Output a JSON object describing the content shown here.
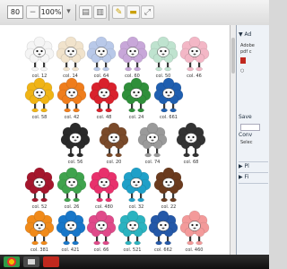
{
  "toolbar": {
    "page_number": "",
    "page_total": "80",
    "zoom": "100%"
  },
  "colors": {
    "accent_panel": "#eef2f7",
    "taskbar": "#1a1a1a",
    "pdf_red": "#c0281e"
  },
  "sheep": [
    {
      "label": "col. 12",
      "color": "#f5f5f5"
    },
    {
      "label": "col. 14",
      "color": "#f1e3cc"
    },
    {
      "label": "col. 64",
      "color": "#b9c9e9"
    },
    {
      "label": "col. 60",
      "color": "#c8a7d9"
    },
    {
      "label": "col. 50",
      "color": "#bfe3cf"
    },
    {
      "label": "col. 46",
      "color": "#f3b7c6"
    },
    {
      "label": "col. 58",
      "color": "#f0b416"
    },
    {
      "label": "col. 42",
      "color": "#ef7d1c"
    },
    {
      "label": "col. 48",
      "color": "#d9212c"
    },
    {
      "label": "col. 24",
      "color": "#2f8f3a"
    },
    {
      "label": "col. 661",
      "color": "#1f5fb0"
    },
    {
      "label": "col. 56",
      "color": "#2a2a2a"
    },
    {
      "label": "col. 20",
      "color": "#7a4a2a"
    },
    {
      "label": "col. 74",
      "color": "#9a9a9a"
    },
    {
      "label": "col. 68",
      "color": "#333333"
    },
    {
      "label": "col. 52",
      "color": "#a5162d"
    },
    {
      "label": "col. 26",
      "color": "#3fa34d"
    },
    {
      "label": "col. 480",
      "color": "#e8316c"
    },
    {
      "label": "col. 32",
      "color": "#1fa0c8"
    },
    {
      "label": "col. 22",
      "color": "#6b3b1e"
    },
    {
      "label": "col. 381",
      "color": "#f08a1a"
    },
    {
      "label": "col. 421",
      "color": "#1877c9"
    },
    {
      "label": "col. 66",
      "color": "#e04a8a"
    },
    {
      "label": "col. 521",
      "color": "#2bb3c0"
    },
    {
      "label": "col. 662",
      "color": "#2458a8"
    },
    {
      "label": "col. 460",
      "color": "#f39a9a"
    }
  ],
  "panel": {
    "heading_1": "▼ Ad",
    "text_1": "Adobe",
    "text_2": "pdf c",
    "heading_2": "Save",
    "heading_3": "Conv",
    "text_3": "Selec",
    "heading_4": "▶ Pl",
    "heading_5": "▶ Fi"
  },
  "taskbar": {
    "apps": [
      "chrome-app",
      "tools-app",
      "acrobat-app"
    ]
  }
}
